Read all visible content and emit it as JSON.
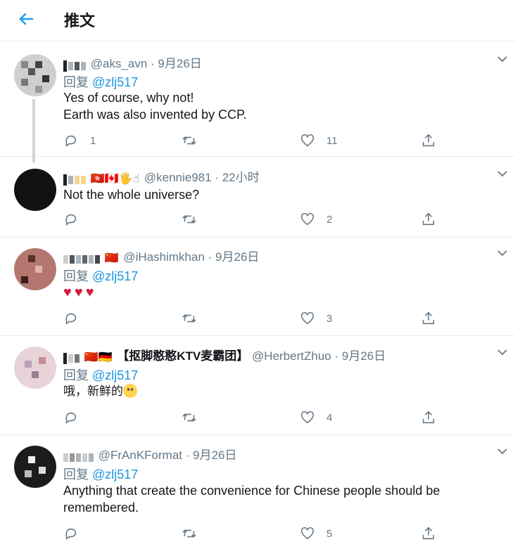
{
  "header": {
    "title": "推文",
    "back_icon": "arrow-left-icon",
    "accent": "#1da1f2"
  },
  "tweets": [
    {
      "handle": "@aks_avn",
      "time": "· 9月26日",
      "reply_prefix": "回复",
      "reply_to": "@zlj517",
      "lines": [
        "Yes of course, why not!",
        "Earth was also invented by CCP."
      ],
      "counts": {
        "reply": "1",
        "retweet": "",
        "like": "11"
      }
    },
    {
      "handle": "@kennie981",
      "time": "· 22小时",
      "emoji": "🇭🇰🇨🇦🖐☝",
      "lines": [
        "Not the whole universe?"
      ],
      "counts": {
        "reply": "",
        "retweet": "",
        "like": "2"
      }
    },
    {
      "handle": "@iHashimkhan",
      "time": "· 9月26日",
      "emoji": "🇨🇳",
      "reply_prefix": "回复",
      "reply_to": "@zlj517",
      "hearts": "♥♥♥",
      "counts": {
        "reply": "",
        "retweet": "",
        "like": "3"
      }
    },
    {
      "handle": "@HerbertZhuo",
      "time": "· 9月26日",
      "emoji": "🇨🇳🇩🇪",
      "display_name": "【抠脚憨憨KTV麦霸团】",
      "reply_prefix": "回复",
      "reply_to": "@zlj517",
      "lines": [
        "哦，新鲜的"
      ],
      "counts": {
        "reply": "",
        "retweet": "",
        "like": "4"
      }
    },
    {
      "handle": "@FrAnKFormat",
      "time": "· 9月26日",
      "reply_prefix": "回复",
      "reply_to": "@zlj517",
      "lines": [
        "Anything that create the convenience for Chinese people should be",
        "remembered."
      ],
      "counts": {
        "reply": "",
        "retweet": "",
        "like": "5"
      }
    }
  ],
  "icons": [
    "reply-icon",
    "retweet-icon",
    "like-icon",
    "share-icon",
    "chevron-down-icon"
  ]
}
